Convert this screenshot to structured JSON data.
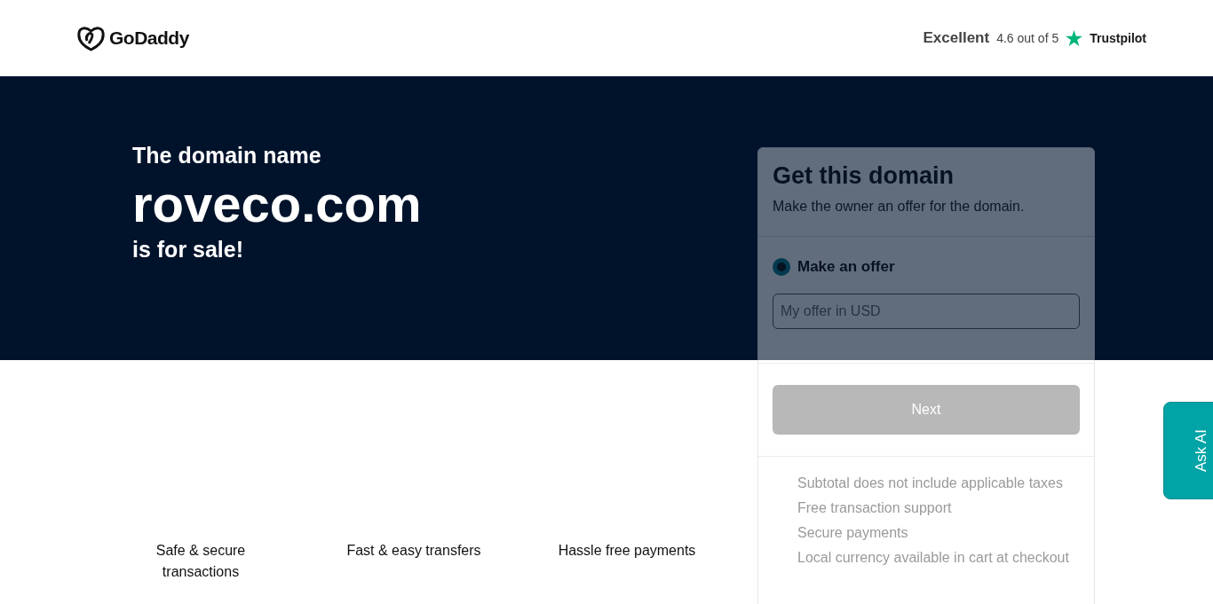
{
  "header": {
    "logo": "GoDaddy",
    "rating": {
      "label": "Excellent",
      "score": "4.6 out of 5",
      "brand": "Trustpilot"
    }
  },
  "hero": {
    "intro": "The domain name",
    "domain": "roveco.com",
    "outro": "is for sale!"
  },
  "offer_card": {
    "title": "Get this domain",
    "subtitle": "Make the owner an offer for the domain.",
    "options": [
      {
        "label": "Make an offer",
        "selected": true
      }
    ],
    "offer_field": {
      "placeholder": "My offer in USD"
    },
    "next_button": {
      "label": "Next",
      "disabled": true
    },
    "notes": [
      "Subtotal does not include applicable taxes",
      "Free transaction support",
      "Secure payments",
      "Local currency available in cart at checkout"
    ]
  },
  "features": [
    "Safe & secure transactions",
    "Fast & easy transfers",
    "Hassle free payments"
  ],
  "ask_ai": {
    "label": "Ask AI"
  }
}
